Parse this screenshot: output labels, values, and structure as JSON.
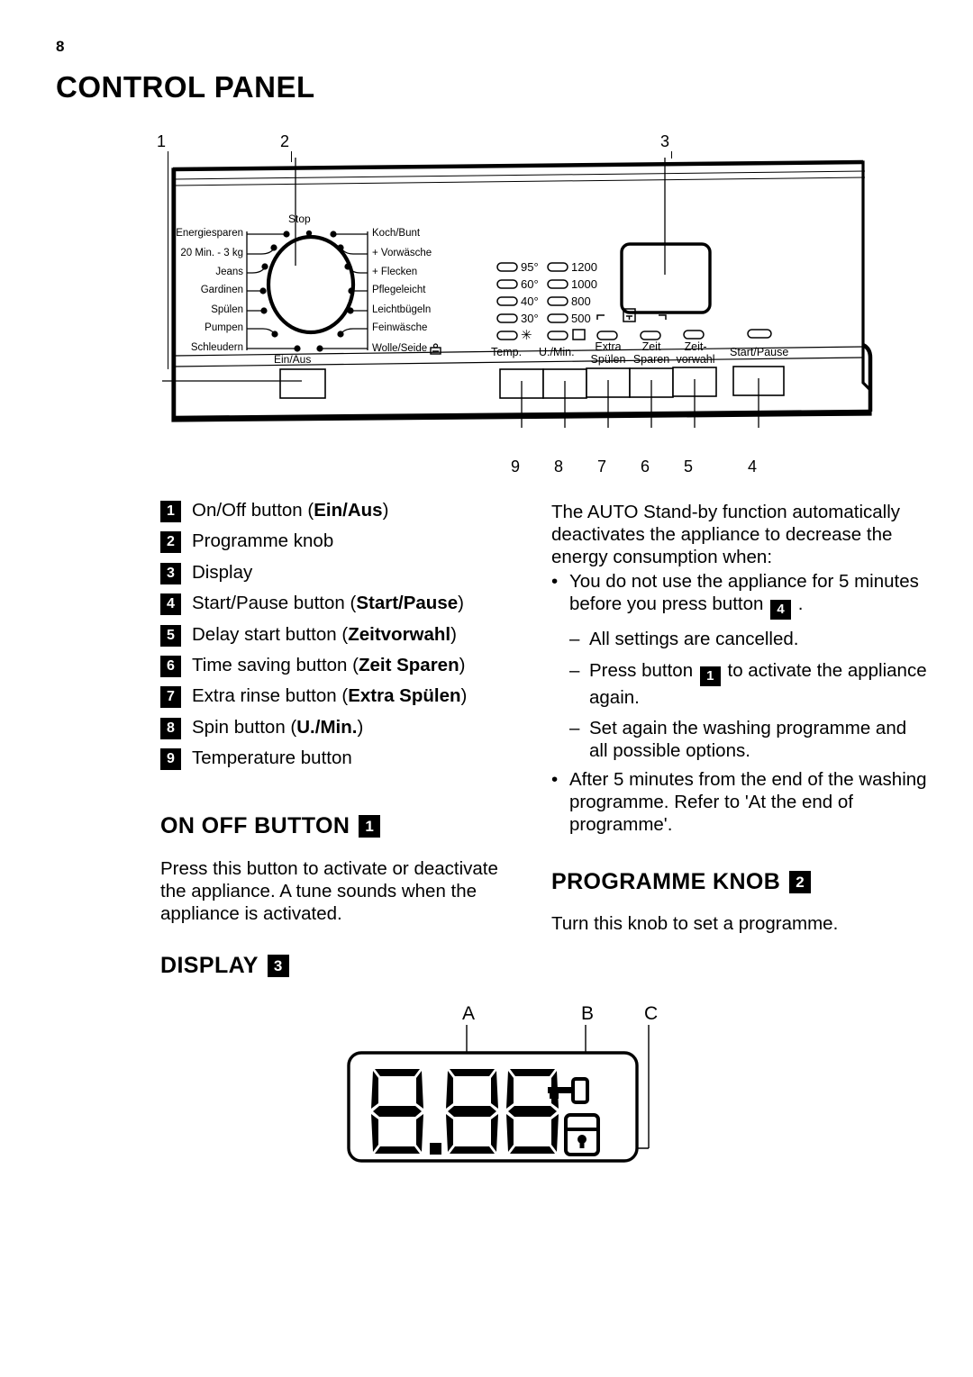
{
  "page": {
    "number": "8",
    "title": "CONTROL PANEL"
  },
  "callouts": {
    "top": [
      "1",
      "2",
      "3"
    ],
    "bottom": [
      "9",
      "8",
      "7",
      "6",
      "5",
      "4"
    ]
  },
  "panel": {
    "knob": {
      "center_label": "Stop",
      "bottom_label": "Ein/Aus",
      "left_programmes": [
        "Energiesparen",
        "20 Min. - 3 kg",
        "Jeans",
        "Gardinen",
        "Spülen",
        "Pumpen",
        "Schleudern"
      ],
      "right_programmes": [
        "Koch/Bunt",
        "+ Vorwäsche",
        "+ Flecken",
        "Pflegeleicht",
        "Leichtbügeln",
        "Feinwäsche",
        "Wolle/Seide"
      ]
    },
    "indicator_columns": [
      {
        "group": "Temp.",
        "leds": [
          "95°",
          "60°",
          "40°",
          "30°",
          "✳"
        ]
      },
      {
        "group": "U./Min.",
        "leds": [
          "1200",
          "1000",
          "800",
          "500",
          "□"
        ]
      }
    ],
    "option_buttons": [
      {
        "label_line1": "Extra",
        "label_line2": "Spülen"
      },
      {
        "label_line1": "Zeit",
        "label_line2": "Sparen"
      },
      {
        "label_line1": "Zeit-",
        "label_line2": "vorwahl"
      }
    ],
    "start_pause_label": "Start/Pause"
  },
  "legend": [
    {
      "num": "1",
      "text": "On/Off button (",
      "bold": "Ein/Aus",
      "tail": ")"
    },
    {
      "num": "2",
      "text": "Programme knob",
      "bold": "",
      "tail": ""
    },
    {
      "num": "3",
      "text": "Display",
      "bold": "",
      "tail": ""
    },
    {
      "num": "4",
      "text": "Start/Pause button (",
      "bold": "Start/Pause",
      "tail": ")"
    },
    {
      "num": "5",
      "text": "Delay start button (",
      "bold": "Zeitvorwahl",
      "tail": ")"
    },
    {
      "num": "6",
      "text": "Time saving button (",
      "bold": "Zeit Sparen",
      "tail": ")"
    },
    {
      "num": "7",
      "text": "Extra rinse button (",
      "bold": "Extra Spülen",
      "tail": ")"
    },
    {
      "num": "8",
      "text": "Spin button (",
      "bold": "U./Min.",
      "tail": ")"
    },
    {
      "num": "9",
      "text": "Temperature button",
      "bold": "",
      "tail": ""
    }
  ],
  "on_off_section": {
    "heading": "ON OFF BUTTON",
    "badge": "1",
    "body": "Press this button to activate or deactivate the appliance. A tune sounds when the appliance is activated."
  },
  "display_section": {
    "heading": "DISPLAY",
    "badge": "3",
    "figure_labels": [
      "A",
      "B",
      "C"
    ],
    "digits": "8.88"
  },
  "standby": {
    "intro": "The AUTO Stand-by function automatically deactivates the appliance to decrease the energy consumption when:",
    "bullet1_pre": "You do not use the appliance for 5 minutes before you press button",
    "bullet1_badge": "4",
    "bullet1_post": ".",
    "sub1": "All settings are cancelled.",
    "sub2_pre": "Press button",
    "sub2_badge": "1",
    "sub2_post": "to activate the appliance again.",
    "sub3": "Set again the washing programme and all possible options.",
    "bullet2": "After 5 minutes from the end of the washing programme. Refer to 'At the end of programme'."
  },
  "programme_knob_section": {
    "heading": "PROGRAMME KNOB",
    "badge": "2",
    "body": "Turn this knob to set a programme."
  }
}
